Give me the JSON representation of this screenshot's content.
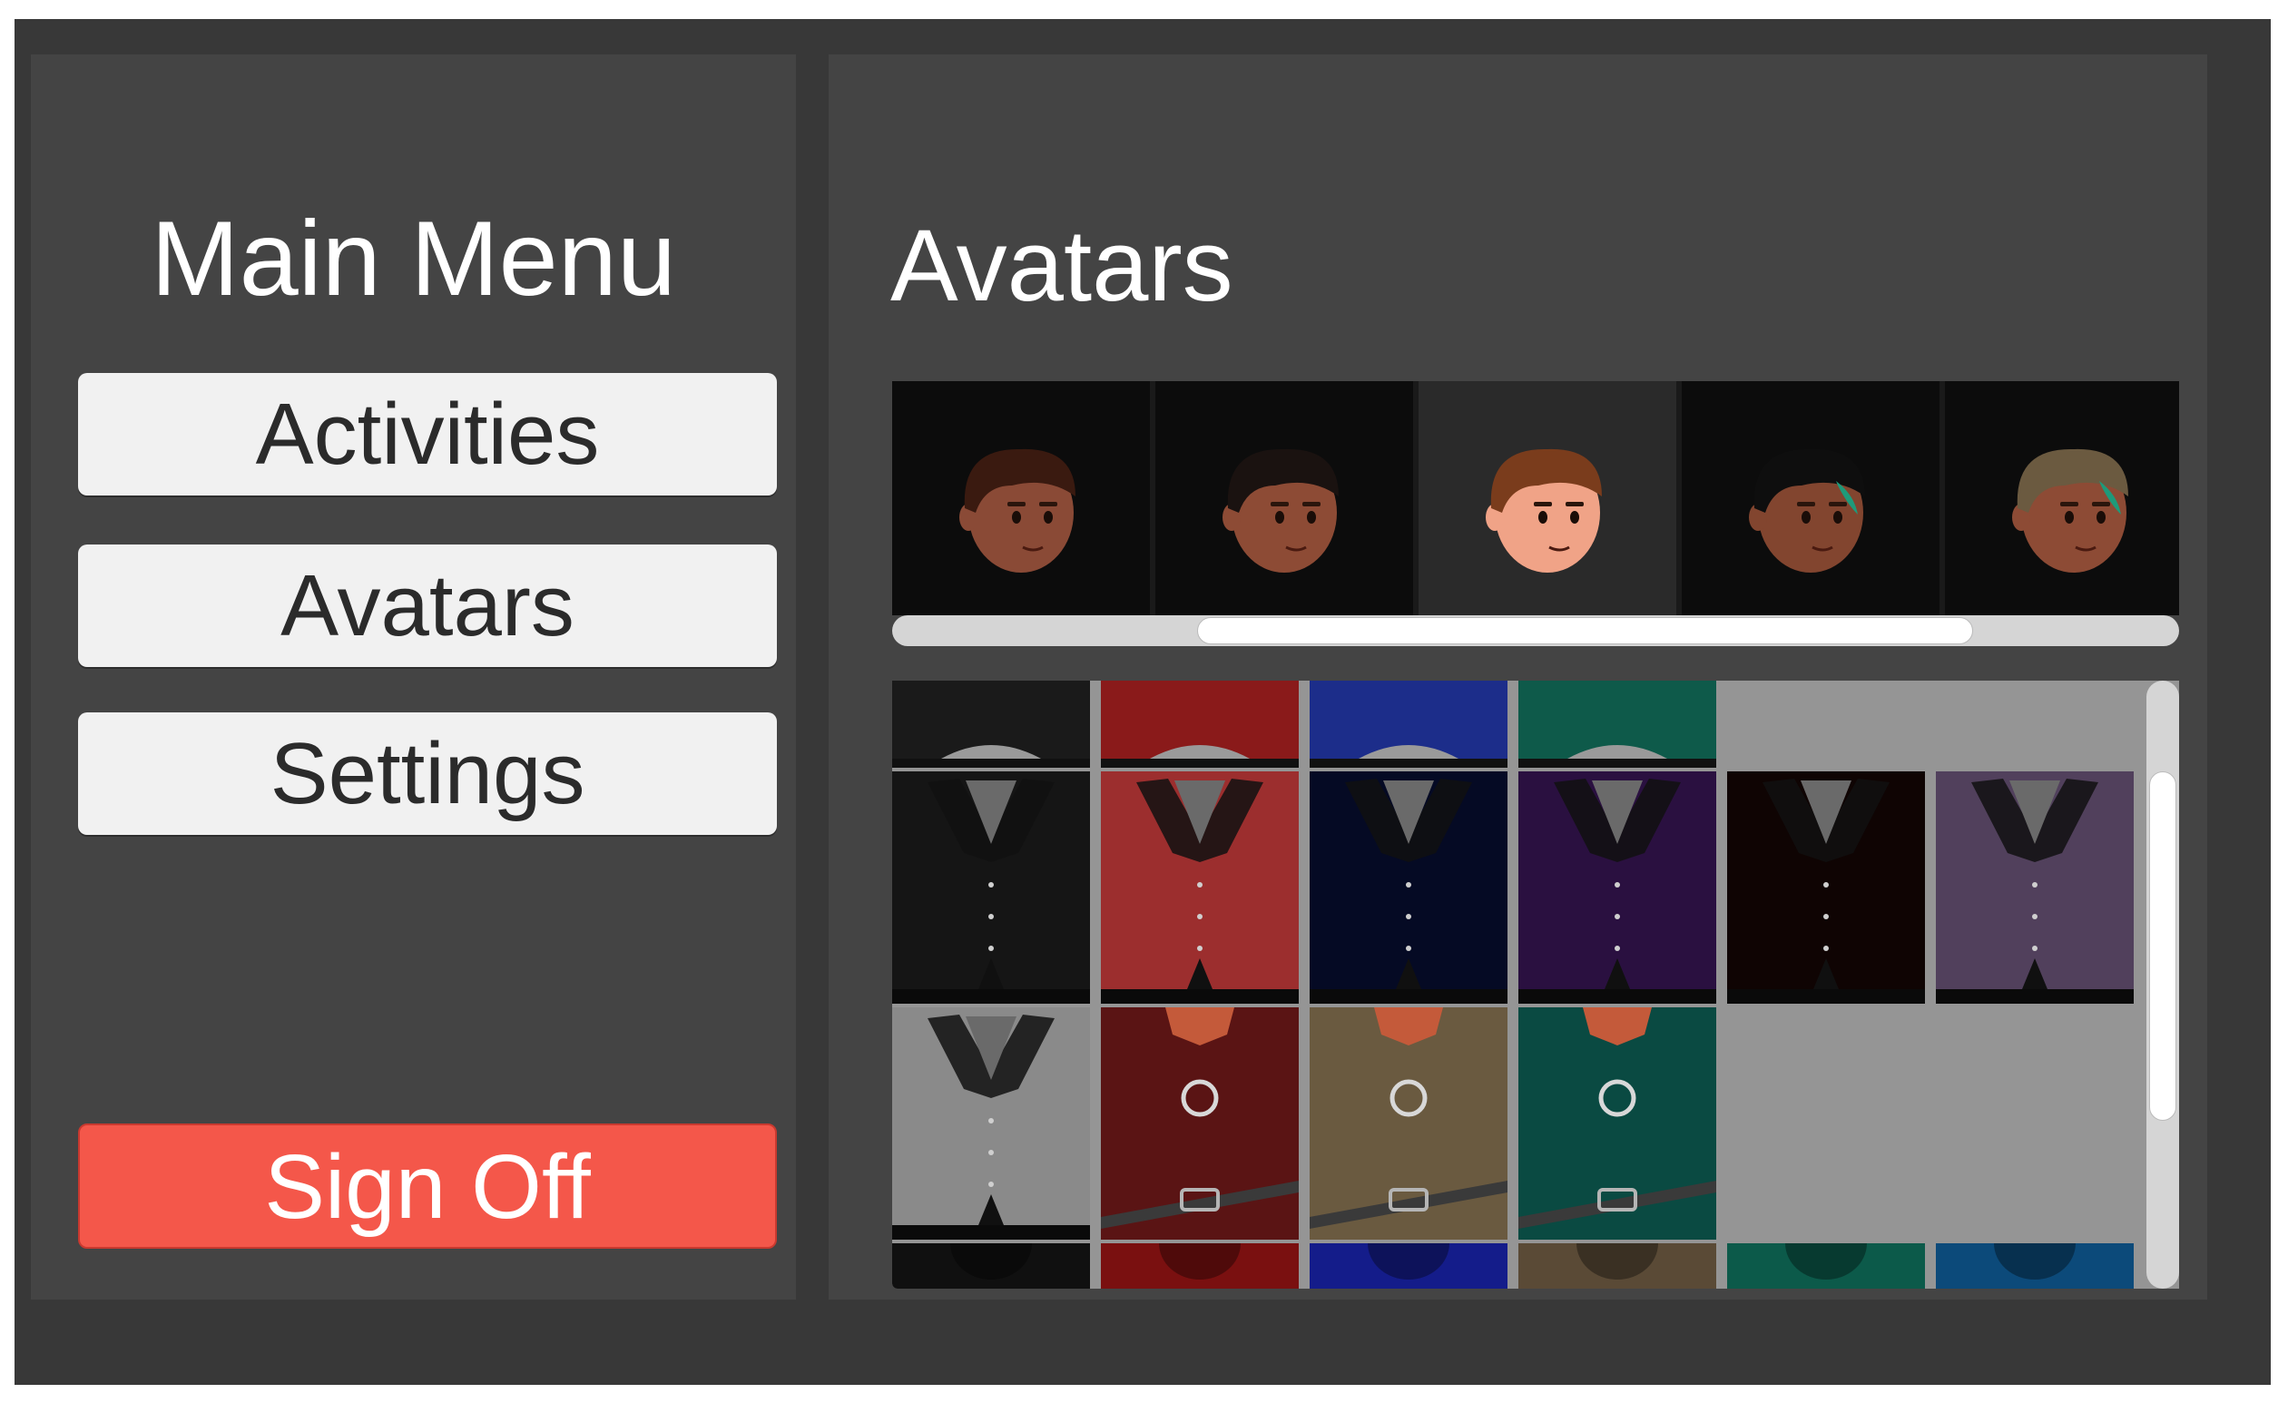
{
  "menu": {
    "title": "Main Menu",
    "activities_label": "Activities",
    "avatars_label": "Avatars",
    "settings_label": "Settings",
    "signoff_label": "Sign Off"
  },
  "avatars_panel": {
    "title": "Avatars",
    "heads": [
      {
        "name": "head-1",
        "skin": "#8a4a36",
        "hair": "#3a1a10",
        "selected": false
      },
      {
        "name": "head-2",
        "skin": "#8d4b35",
        "hair": "#1a1210",
        "selected": false
      },
      {
        "name": "head-3",
        "skin": "#f0a387",
        "hair": "#7a3c1c",
        "selected": true
      },
      {
        "name": "head-4",
        "skin": "#82452f",
        "hair": "#0e0e0e",
        "accent": "#1e9a7a",
        "selected": false
      },
      {
        "name": "head-5",
        "skin": "#8d4b35",
        "hair": "#6b5a40",
        "accent": "#1e9a7a",
        "selected": false
      }
    ],
    "head_scroll_position": 0.6,
    "outfit_scroll_position": 0.35,
    "outfit_rows": [
      [
        {
          "style": "pants",
          "color": "#1a1a1a"
        },
        {
          "style": "pants",
          "color": "#8a1a1a"
        },
        {
          "style": "pants",
          "color": "#1c2d8a"
        },
        {
          "style": "pants",
          "color": "#0e5a4a"
        }
      ],
      [
        {
          "style": "vest",
          "color": "#151515"
        },
        {
          "style": "vest",
          "color": "#9c2e2e"
        },
        {
          "style": "vest",
          "color": "#050a24"
        },
        {
          "style": "vest",
          "color": "#2a1040"
        },
        {
          "style": "vest",
          "color": "#0f0403"
        },
        {
          "style": "vest",
          "color": "#51405c"
        }
      ],
      [
        {
          "style": "vest",
          "color": "#8a8a8a"
        },
        {
          "style": "shirt",
          "color": "#5a1414"
        },
        {
          "style": "shirt",
          "color": "#6a5a40"
        },
        {
          "style": "shirt",
          "color": "#0a4a42"
        }
      ],
      [
        {
          "style": "strip",
          "color": "#101010"
        },
        {
          "style": "strip",
          "color": "#7a1010"
        },
        {
          "style": "strip",
          "color": "#141c8a"
        },
        {
          "style": "strip",
          "color": "#5a4a36"
        },
        {
          "style": "strip",
          "color": "#0c5a4a"
        },
        {
          "style": "strip",
          "color": "#0c4a7a"
        }
      ]
    ],
    "colors": {
      "signoff": "#f4574a",
      "button": "#f1f1f1",
      "panel": "#444444",
      "frame": "#383838"
    }
  }
}
